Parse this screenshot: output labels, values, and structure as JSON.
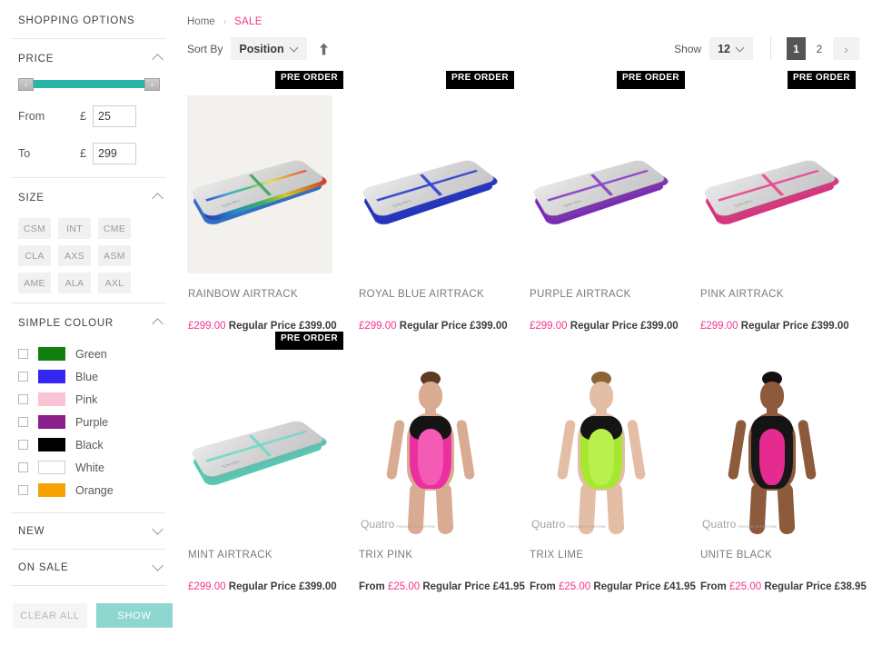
{
  "sidebar": {
    "title": "SHOPPING OPTIONS",
    "price": {
      "heading": "PRICE",
      "from_label": "From",
      "to_label": "To",
      "currency": "£",
      "from_value": "25",
      "to_value": "299",
      "handle_left_icon": "›",
      "handle_right_icon": "‹",
      "track_color": "#29b5a8"
    },
    "size": {
      "heading": "SIZE",
      "options": [
        "CSM",
        "INT",
        "CME",
        "CLA",
        "AXS",
        "ASM",
        "AME",
        "ALA",
        "AXL"
      ]
    },
    "colour": {
      "heading": "SIMPLE COLOUR",
      "options": [
        {
          "label": "Green",
          "hex": "#12800e"
        },
        {
          "label": "Blue",
          "hex": "#3325f2"
        },
        {
          "label": "Pink",
          "hex": "#f9c3d4"
        },
        {
          "label": "Purple",
          "hex": "#8c1f8c"
        },
        {
          "label": "Black",
          "hex": "#000000"
        },
        {
          "label": "White",
          "hex": "#ffffff"
        },
        {
          "label": "Orange",
          "hex": "#f5a300"
        }
      ]
    },
    "collapsed_sections": [
      {
        "heading": "NEW"
      },
      {
        "heading": "ON SALE"
      }
    ],
    "actions": {
      "clear_label": "CLEAR ALL",
      "show_label": "SHOW",
      "show_color": "#8ed7d1"
    }
  },
  "breadcrumb": {
    "home": "Home",
    "separator": "›",
    "current": "SALE",
    "current_color": "#f4358c"
  },
  "toolbar": {
    "sort_by_label": "Sort By",
    "sort_value": "Position",
    "sort_direction_icon": "arrow-up",
    "show_label": "Show",
    "show_value": "12",
    "pages": [
      "1",
      "2"
    ],
    "active_page": "1",
    "next_icon": "›"
  },
  "products": [
    {
      "badge": "PRE ORDER",
      "name": "RAINBOW AIRTRACK",
      "sale_price": "£299.00",
      "regular_label": "Regular Price",
      "regular_price": "£399.00",
      "image_type": "airtrack",
      "tinted": true,
      "color": "#3aa5dd",
      "accent": "#2f6fc4",
      "logo": "Quatro"
    },
    {
      "badge": "PRE ORDER",
      "name": "ROYAL BLUE AIRTRACK",
      "sale_price": "£299.00",
      "regular_label": "Regular Price",
      "regular_price": "£399.00",
      "image_type": "airtrack",
      "tinted": false,
      "color": "#2b3fd4",
      "accent": "#2435bb",
      "logo": "Quatro"
    },
    {
      "badge": "PRE ORDER",
      "name": "PURPLE AIRTRACK",
      "sale_price": "£299.00",
      "regular_label": "Regular Price",
      "regular_price": "£399.00",
      "image_type": "airtrack",
      "tinted": false,
      "color": "#8b3fc4",
      "accent": "#7a2bb5",
      "logo": "Quatro"
    },
    {
      "badge": "PRE ORDER",
      "name": "PINK AIRTRACK",
      "sale_price": "£299.00",
      "regular_label": "Regular Price",
      "regular_price": "£399.00",
      "image_type": "airtrack",
      "tinted": false,
      "color": "#e8468f",
      "accent": "#d8337e",
      "logo": "Quatro"
    },
    {
      "badge": "PRE ORDER",
      "name": "MINT AIRTRACK",
      "sale_price": "£299.00",
      "regular_label": "Regular Price",
      "regular_price": "£399.00",
      "image_type": "airtrack",
      "tinted": false,
      "color": "#6fd9c7",
      "accent": "#55c9b5",
      "logo": "Quatro"
    },
    {
      "badge": "",
      "name": "TRIX PINK",
      "from_label": "From",
      "sale_price": "£25.00",
      "regular_label": "Regular Price",
      "regular_price": "£41.95",
      "image_type": "leotard",
      "tinted": false,
      "suit_color": "#ec2fa0",
      "panel_color": "#f45bb4",
      "hair_color": "#5d3a22",
      "skin_color": "#d8ab92",
      "watermark": "Quatro",
      "watermark_sub": "FREEDOM TO PERFORM"
    },
    {
      "badge": "",
      "name": "TRIX LIME",
      "from_label": "From",
      "sale_price": "£25.00",
      "regular_label": "Regular Price",
      "regular_price": "£41.95",
      "image_type": "leotard",
      "tinted": false,
      "suit_color": "#a6e830",
      "panel_color": "#b9f04d",
      "hair_color": "#8a6436",
      "skin_color": "#e3bda4",
      "watermark": "Quatro",
      "watermark_sub": "FREEDOM TO PERFORM"
    },
    {
      "badge": "",
      "name": "UNITE BLACK",
      "from_label": "From",
      "sale_price": "£25.00",
      "regular_label": "Regular Price",
      "regular_price": "£38.95",
      "image_type": "leotard",
      "tinted": false,
      "suit_color": "#17171a",
      "panel_color": "#e52a90",
      "hair_color": "#14100e",
      "skin_color": "#8d5a3c",
      "watermark": "Quatro",
      "watermark_sub": "FREEDOM TO PERFORM"
    }
  ]
}
